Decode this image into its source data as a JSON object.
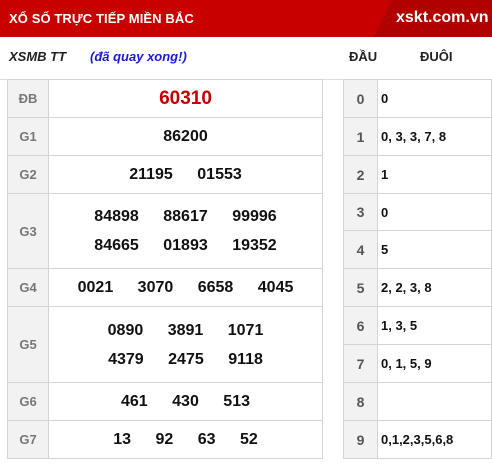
{
  "header": {
    "title": "XỔ SỐ TRỰC TIẾP MIỀN BẮC",
    "logo": "xskt.com.vn"
  },
  "subheader": {
    "label": "XSMB TT",
    "status": "(đã quay xong!)",
    "dau": "ĐẦU",
    "duoi": "ĐUÔI"
  },
  "prizes": [
    {
      "name": "ĐB",
      "rows": [
        [
          "60310"
        ]
      ]
    },
    {
      "name": "G1",
      "rows": [
        [
          "86200"
        ]
      ]
    },
    {
      "name": "G2",
      "rows": [
        [
          "21195",
          "01553"
        ]
      ]
    },
    {
      "name": "G3",
      "rows": [
        [
          "84898",
          "88617",
          "99996"
        ],
        [
          "84665",
          "01893",
          "19352"
        ]
      ]
    },
    {
      "name": "G4",
      "rows": [
        [
          "0021",
          "3070",
          "6658",
          "4045"
        ]
      ]
    },
    {
      "name": "G5",
      "rows": [
        [
          "0890",
          "3891",
          "1071"
        ],
        [
          "4379",
          "2475",
          "9118"
        ]
      ]
    },
    {
      "name": "G6",
      "rows": [
        [
          "461",
          "430",
          "513"
        ]
      ]
    },
    {
      "name": "G7",
      "rows": [
        [
          "13",
          "92",
          "63",
          "52"
        ]
      ]
    }
  ],
  "loto": [
    {
      "head": "0",
      "tail": "0"
    },
    {
      "head": "1",
      "tail": "0, 3, 3, 7, 8"
    },
    {
      "head": "2",
      "tail": "1"
    },
    {
      "head": "3",
      "tail": "0"
    },
    {
      "head": "4",
      "tail": "5"
    },
    {
      "head": "5",
      "tail": "2, 2, 3, 8"
    },
    {
      "head": "6",
      "tail": "1, 3, 5"
    },
    {
      "head": "7",
      "tail": "0, 1, 5, 9"
    },
    {
      "head": "8",
      "tail": ""
    },
    {
      "head": "9",
      "tail": "0,1,2,3,5,6,8"
    }
  ]
}
